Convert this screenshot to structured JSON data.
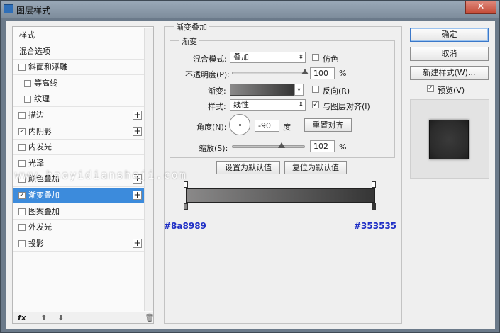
{
  "window": {
    "title": "图层样式",
    "close_glyph": "✕"
  },
  "styles_list": {
    "items": [
      {
        "label": "样式",
        "checkbox": false,
        "checked": false,
        "plus": false,
        "indent": 0
      },
      {
        "label": "混合选项",
        "checkbox": false,
        "checked": false,
        "plus": false,
        "indent": 0
      },
      {
        "label": "斜面和浮雕",
        "checkbox": true,
        "checked": false,
        "plus": false,
        "indent": 0
      },
      {
        "label": "等高线",
        "checkbox": true,
        "checked": false,
        "plus": false,
        "indent": 1
      },
      {
        "label": "纹理",
        "checkbox": true,
        "checked": false,
        "plus": false,
        "indent": 1
      },
      {
        "label": "描边",
        "checkbox": true,
        "checked": false,
        "plus": true,
        "indent": 0
      },
      {
        "label": "内阴影",
        "checkbox": true,
        "checked": true,
        "plus": true,
        "indent": 0
      },
      {
        "label": "内发光",
        "checkbox": true,
        "checked": false,
        "plus": false,
        "indent": 0
      },
      {
        "label": "光泽",
        "checkbox": true,
        "checked": false,
        "plus": false,
        "indent": 0
      },
      {
        "label": "颜色叠加",
        "checkbox": true,
        "checked": false,
        "plus": true,
        "indent": 0
      },
      {
        "label": "渐变叠加",
        "checkbox": true,
        "checked": true,
        "plus": true,
        "indent": 0,
        "selected": true
      },
      {
        "label": "图案叠加",
        "checkbox": true,
        "checked": false,
        "plus": false,
        "indent": 0
      },
      {
        "label": "外发光",
        "checkbox": true,
        "checked": false,
        "plus": false,
        "indent": 0
      },
      {
        "label": "投影",
        "checkbox": true,
        "checked": false,
        "plus": true,
        "indent": 0
      }
    ],
    "footer": {
      "fx": "fx",
      "up": "⬆",
      "down": "⬇",
      "trash": "🗑"
    }
  },
  "gradient_overlay": {
    "section_title": "渐变叠加",
    "group_title": "渐变",
    "blend_mode_label": "混合模式:",
    "blend_mode_value": "叠加",
    "dither_label": "仿色",
    "opacity_label": "不透明度(P):",
    "opacity_value": "100",
    "opacity_unit": "%",
    "opacity_level": 1.0,
    "gradient_label": "渐变:",
    "reverse_label": "反向(R)",
    "style_label": "样式:",
    "style_value": "线性",
    "align_label": "与图层对齐(I)",
    "align_checked": true,
    "angle_label": "角度(N):",
    "angle_value": "-90",
    "angle_unit": "度",
    "reset_align_label": "重置对齐",
    "scale_label": "缩放(S):",
    "scale_value": "102",
    "scale_unit": "%",
    "scale_level": 0.68,
    "make_default_label": "设置为默认值",
    "reset_default_label": "复位为默认值"
  },
  "gradient_editor": {
    "left_hex": "#8a8989",
    "right_hex": "#353535",
    "colors": {
      "start": "#8a8989",
      "end": "#353535"
    }
  },
  "watermark": "www.haoyidiansheji.com",
  "actions": {
    "ok_label": "确定",
    "cancel_label": "取消",
    "new_style_label": "新建样式(W)...",
    "preview_label": "预览(V)",
    "preview_checked": true
  },
  "icons": {
    "check": "✓",
    "plus": "+",
    "caret": "⬍",
    "dropdown": "▾"
  }
}
